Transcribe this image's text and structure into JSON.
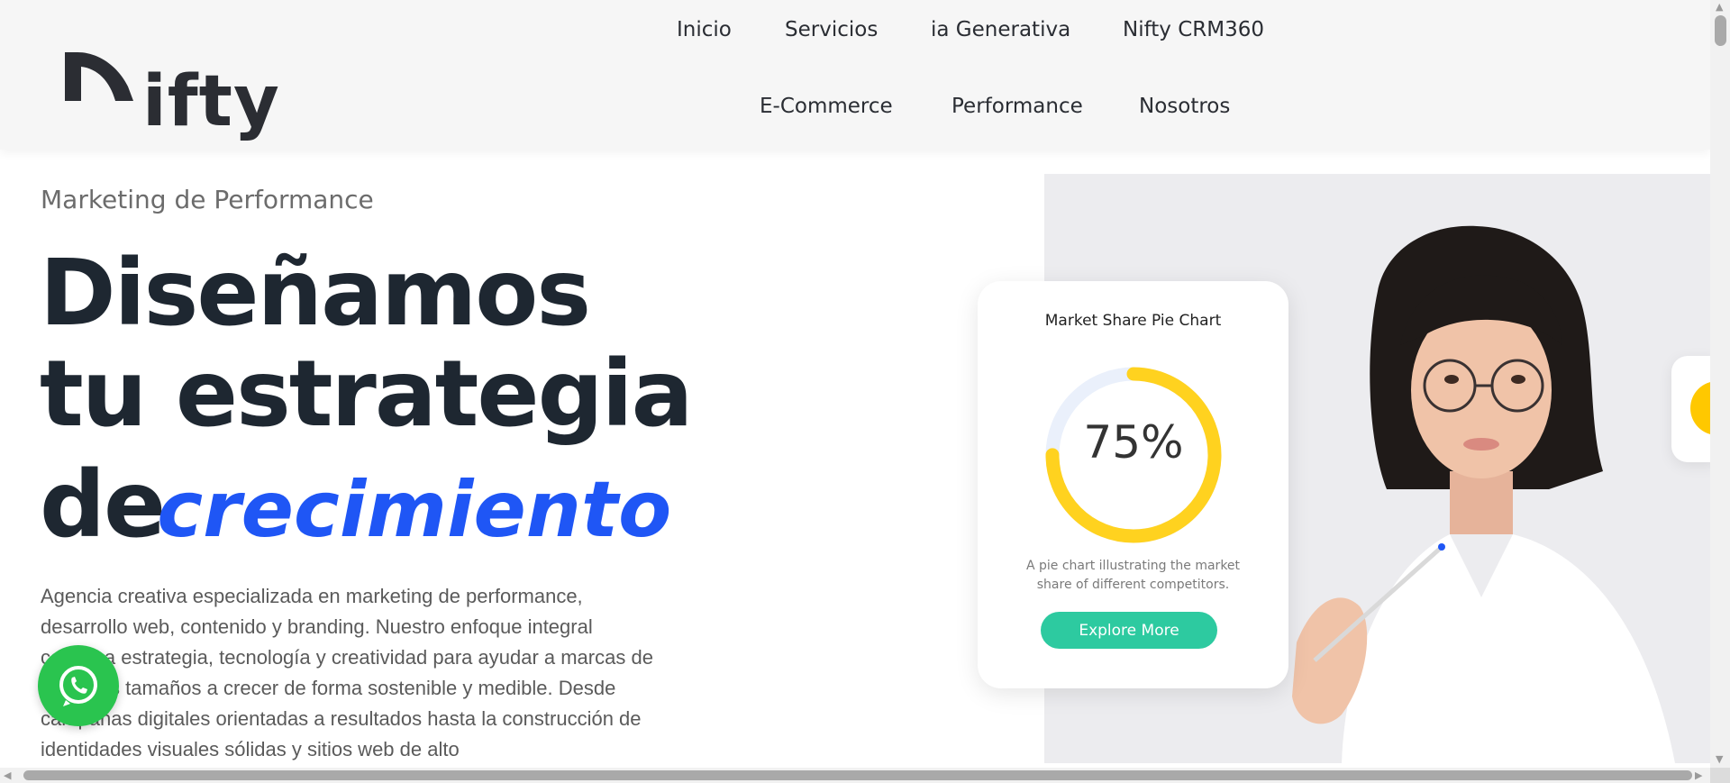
{
  "brand": {
    "logo_text": "ifty"
  },
  "nav": {
    "items": [
      "Inicio",
      "Servicios",
      "ia Generativa",
      "Nifty CRM360",
      "E-Commerce",
      "Performance",
      "Nosotros"
    ]
  },
  "hero": {
    "eyebrow": "Marketing de Performance",
    "headline_line1": "Diseñamos",
    "headline_line2": "tu estrategia",
    "headline_line3_prefix": "de",
    "headline_line3_accent": "crecimiento",
    "body": "Agencia creativa especializada en marketing de performance, desarrollo web, contenido y branding. Nuestro enfoque integral combina estrategia, tecnología y creatividad para ayudar a marcas de todos los tamaños a crecer de forma sostenible y medible. Desde campañas digitales orientadas a resultados hasta la construcción de identidades visuales sólidas y sitios web de alto"
  },
  "card": {
    "title": "Market Share Pie Chart",
    "value_label": "75%",
    "value": 0.75,
    "description": "A pie chart illustrating the market share of different competitors.",
    "button_label": "Explore More"
  },
  "colors": {
    "accent_blue": "#1f56f5",
    "donut_yellow": "#ffd21f",
    "button_teal": "#2dcaa0",
    "whatsapp_green": "#2ac44f",
    "headline_dark": "#1e2731"
  },
  "icons": {
    "whatsapp": "whatsapp-icon"
  }
}
